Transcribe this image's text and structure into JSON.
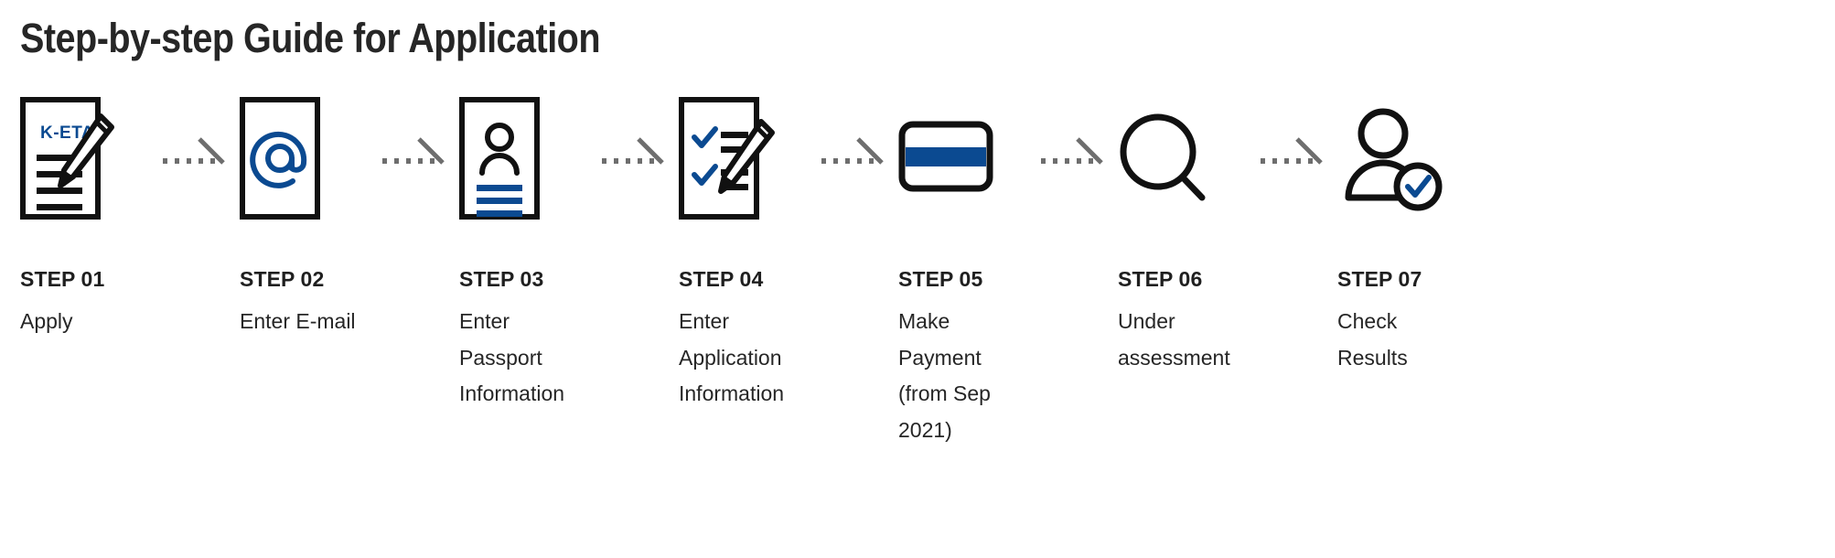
{
  "header": {
    "title": "Step-by-step Guide for Application"
  },
  "colors": {
    "accent_blue": "#0B4A91",
    "icon_black": "#111111",
    "text": "#262626",
    "connector_gray": "#6e6e6e"
  },
  "connector": {
    "icon_name": "dotted-arrow-icon",
    "count": 6
  },
  "steps": [
    {
      "label": "STEP 01",
      "description": "Apply",
      "icon": "document-keta-pencil-icon",
      "badge_text": "K-ETA"
    },
    {
      "label": "STEP 02",
      "description": "Enter E-mail",
      "icon": "document-email-at-icon"
    },
    {
      "label": "STEP 03",
      "description": "Enter Passport Information",
      "icon": "passport-person-card-icon"
    },
    {
      "label": "STEP 04",
      "description": "Enter Application Information",
      "icon": "checklist-pencil-icon"
    },
    {
      "label": "STEP 05",
      "description": "Make Payment (from Sep 2021)",
      "icon": "credit-card-icon"
    },
    {
      "label": "STEP 06",
      "description": "Under assessment",
      "icon": "magnifying-glass-icon"
    },
    {
      "label": "STEP 07",
      "description": "Check Results",
      "icon": "person-verified-check-icon"
    }
  ]
}
